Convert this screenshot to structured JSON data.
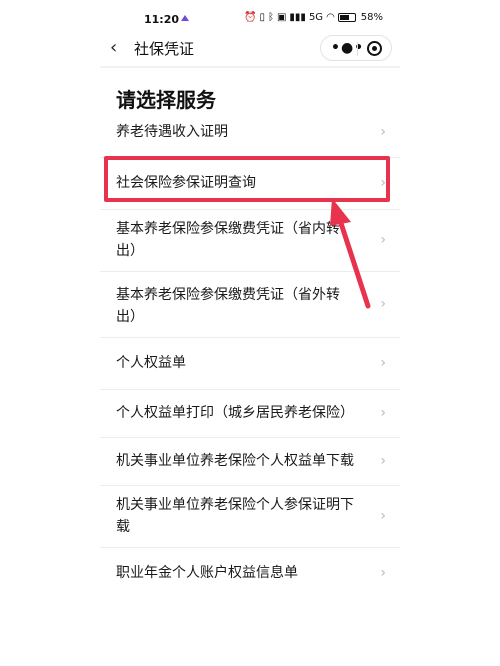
{
  "status_bar": {
    "time": "11:20",
    "signal_text": "5G",
    "battery_text": "58%"
  },
  "nav": {
    "title": "社保凭证",
    "back_icon": "chevron-left-icon",
    "more_icon": "more-dots-icon",
    "close_icon": "target-circle-icon"
  },
  "page": {
    "heading": "请选择服务"
  },
  "services": [
    {
      "label": "养老待遇收入证明"
    },
    {
      "label": "社会保险参保证明查询"
    },
    {
      "label": "基本养老保险参保缴费凭证（省内转出）"
    },
    {
      "label": "基本养老保险参保缴费凭证（省外转出）"
    },
    {
      "label": "个人权益单"
    },
    {
      "label": "个人权益单打印（城乡居民养老保险）"
    },
    {
      "label": "机关事业单位养老保险个人权益单下载"
    },
    {
      "label": "机关事业单位养老保险个人参保证明下载"
    },
    {
      "label": "职业年金个人账户权益信息单"
    }
  ],
  "colors": {
    "highlight": "#e8334f",
    "chevron": "#b8b8b8"
  }
}
